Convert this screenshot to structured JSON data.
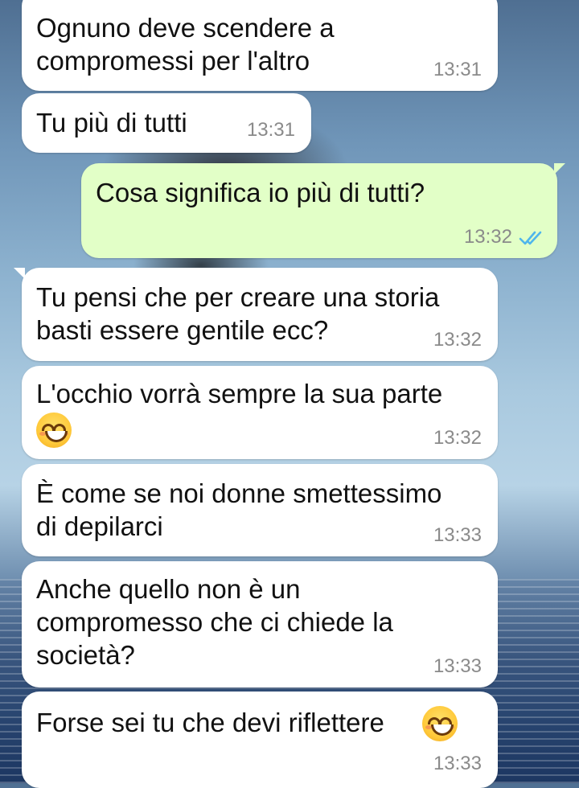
{
  "messages": [
    {
      "text": "Ognuno deve scendere a\ncompromessi per l'altro",
      "time": "13:31",
      "direction": "incoming"
    },
    {
      "text": "Tu più di tutti",
      "time": "13:31",
      "direction": "incoming"
    },
    {
      "text": "Cosa significa io più di tutti?",
      "time": "13:32",
      "direction": "outgoing",
      "status": "read"
    },
    {
      "text": "Tu pensi che per creare una storia\nbasti essere gentile ecc?",
      "time": "13:32",
      "direction": "incoming"
    },
    {
      "text": "L'occhio vorrà sempre la sua parte",
      "time": "13:32",
      "direction": "incoming",
      "emoji": "smiling-face-icon"
    },
    {
      "text": "È come se noi donne smettessimo\ndi depilarci",
      "time": "13:33",
      "direction": "incoming"
    },
    {
      "text": "Anche quello non è un\ncompromesso che ci chiede la\nsocietà?",
      "time": "13:33",
      "direction": "incoming"
    },
    {
      "text": "Forse sei tu che devi riflettere",
      "time": "13:33",
      "direction": "incoming",
      "emoji": "smiling-face-icon"
    }
  ],
  "colors": {
    "incoming_bubble": "#ffffff",
    "outgoing_bubble": "#e2ffc7",
    "timestamp": "#8a8a8a",
    "read_ticks": "#4fb6ec"
  }
}
